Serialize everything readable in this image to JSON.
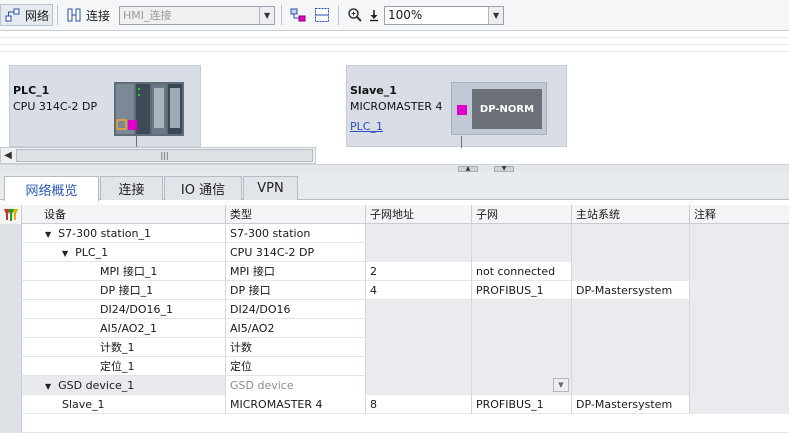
{
  "toolbar": {
    "network_label": "网络",
    "connection_label": "连接",
    "connection_type": "HMI_连接",
    "zoom_value": "100%"
  },
  "devices": [
    {
      "name": "PLC_1",
      "type": "CPU 314C-2 DP",
      "link": ""
    },
    {
      "name": "Slave_1",
      "type": "MICROMASTER 4",
      "link": "PLC_1",
      "module_label": "DP-NORM"
    }
  ],
  "tabs": [
    {
      "label": "网络概览",
      "active": true
    },
    {
      "label": "连接",
      "active": false
    },
    {
      "label": "IO 通信",
      "active": false
    },
    {
      "label": "VPN",
      "active": false
    }
  ],
  "table": {
    "headers": [
      "设备",
      "类型",
      "子网地址",
      "子网",
      "主站系统",
      "注释"
    ],
    "rows": [
      {
        "device": "S7-300 station_1",
        "type": "S7-300 station",
        "addr": "",
        "subnet": "",
        "master": "",
        "comment": "",
        "level": 1,
        "expander": "down"
      },
      {
        "device": "PLC_1",
        "type": "CPU 314C-2 DP",
        "addr": "",
        "subnet": "",
        "master": "",
        "comment": "",
        "level": 2,
        "expander": "down"
      },
      {
        "device": "MPI 接口_1",
        "type": "MPI 接口",
        "addr": "2",
        "subnet": "not connected",
        "master": "",
        "comment": "",
        "level": 3
      },
      {
        "device": "DP 接口_1",
        "type": "DP 接口",
        "addr": "4",
        "subnet": "PROFIBUS_1",
        "master": "DP-Mastersystem",
        "comment": "",
        "level": 3
      },
      {
        "device": "DI24/DO16_1",
        "type": "DI24/DO16",
        "addr": "",
        "subnet": "",
        "master": "",
        "comment": "",
        "level": 3
      },
      {
        "device": "AI5/AO2_1",
        "type": "AI5/AO2",
        "addr": "",
        "subnet": "",
        "master": "",
        "comment": "",
        "level": 3
      },
      {
        "device": "计数_1",
        "type": "计数",
        "addr": "",
        "subnet": "",
        "master": "",
        "comment": "",
        "level": 3
      },
      {
        "device": "定位_1",
        "type": "定位",
        "addr": "",
        "subnet": "",
        "master": "",
        "comment": "",
        "level": 3
      },
      {
        "device": "GSD device_1",
        "type": "GSD device",
        "addr": "",
        "subnet": "",
        "master": "",
        "comment": "",
        "level": 1,
        "expander": "down"
      },
      {
        "device": "Slave_1",
        "type": "MICROMASTER 4",
        "addr": "8",
        "subnet": "PROFIBUS_1",
        "master": "DP-Mastersystem",
        "comment": "",
        "level": 2
      }
    ]
  },
  "colors": {
    "accent_magenta": "#e000c8",
    "device_bg": "#d9dde6",
    "tab_active_text": "#2b59b8"
  }
}
